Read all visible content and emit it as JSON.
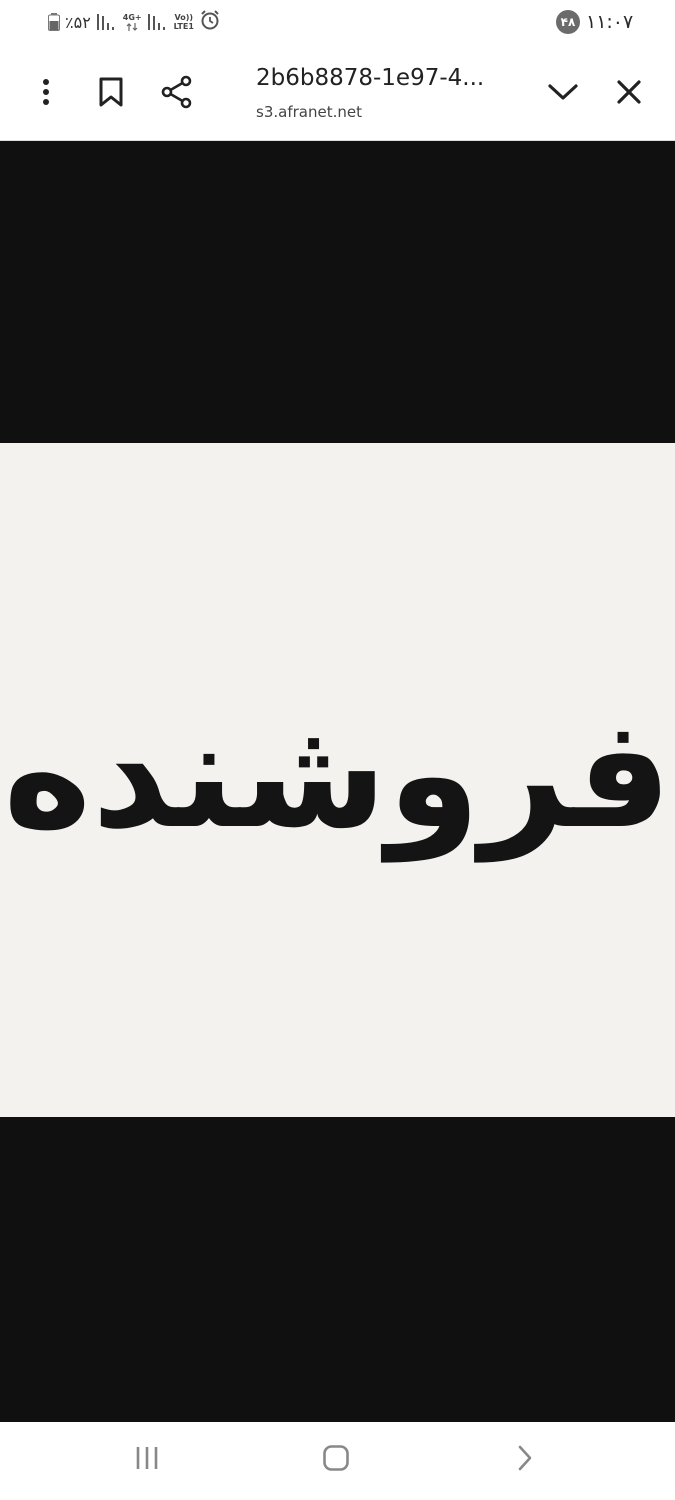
{
  "status_bar": {
    "notification_count": "۴۸",
    "time": "۱۱:۰۷",
    "battery_percent": "٪۵۲",
    "network_type": "4G+",
    "volte_top": "Vo))",
    "volte_bottom": "LTE1",
    "icons": [
      "battery-icon",
      "signal-icon",
      "network-4g-icon",
      "signal-icon",
      "volte-icon",
      "alarm-icon"
    ]
  },
  "toolbar": {
    "title": "2b6b8878-1e97-4...",
    "domain": "s3.afranet.net",
    "icons": [
      "more-vert-icon",
      "bookmark-icon",
      "share-icon",
      "chevron-down-icon",
      "close-icon"
    ]
  },
  "content": {
    "image_text": "فروشنده"
  },
  "nav_bar": {
    "icons": [
      "recent-apps-icon",
      "home-icon",
      "back-icon"
    ]
  }
}
